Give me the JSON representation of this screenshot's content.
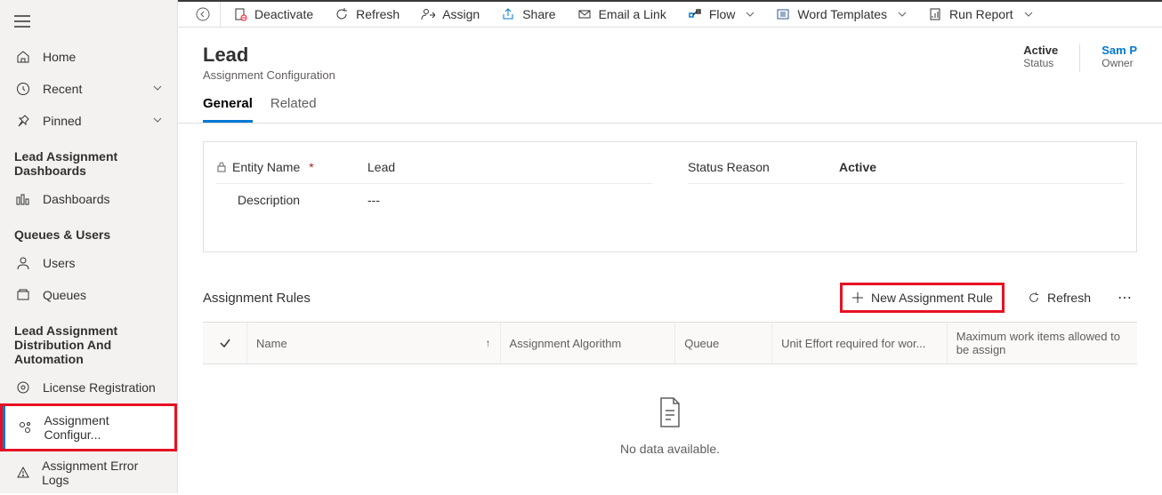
{
  "sidebar": {
    "primary": [
      {
        "label": "Home",
        "icon": "home"
      },
      {
        "label": "Recent",
        "icon": "clock",
        "expandable": true
      },
      {
        "label": "Pinned",
        "icon": "pin",
        "expandable": true
      }
    ],
    "groups": [
      {
        "title": "Lead Assignment Dashboards",
        "items": [
          {
            "label": "Dashboards",
            "icon": "dashboard"
          }
        ]
      },
      {
        "title": "Queues & Users",
        "items": [
          {
            "label": "Users",
            "icon": "person"
          },
          {
            "label": "Queues",
            "icon": "queue"
          }
        ]
      },
      {
        "title": "Lead Assignment Distribution And Automation",
        "items": [
          {
            "label": "License Registration",
            "icon": "license"
          },
          {
            "label": "Assignment Configur...",
            "icon": "config",
            "active": true
          },
          {
            "label": "Assignment Error Logs",
            "icon": "errorlog"
          }
        ]
      }
    ]
  },
  "commandbar": [
    {
      "label": "Deactivate",
      "icon": "deactivate"
    },
    {
      "label": "Refresh",
      "icon": "refresh"
    },
    {
      "label": "Assign",
      "icon": "assign"
    },
    {
      "label": "Share",
      "icon": "share"
    },
    {
      "label": "Email a Link",
      "icon": "email"
    },
    {
      "label": "Flow",
      "icon": "flow",
      "dropdown": true
    },
    {
      "label": "Word Templates",
      "icon": "word",
      "dropdown": true
    },
    {
      "label": "Run Report",
      "icon": "report",
      "dropdown": true
    }
  ],
  "header": {
    "title": "Lead",
    "subtitle": "Assignment Configuration",
    "status_value": "Active",
    "status_label": "Status",
    "owner_value": "Sam P",
    "owner_label": "Owner"
  },
  "tabs": [
    {
      "label": "General",
      "active": true
    },
    {
      "label": "Related"
    }
  ],
  "form": {
    "entity_name_label": "Entity Name",
    "entity_name_value": "Lead",
    "status_reason_label": "Status Reason",
    "status_reason_value": "Active",
    "description_label": "Description",
    "description_value": "---"
  },
  "assignment_rules": {
    "title": "Assignment Rules",
    "new_button": "New Assignment Rule",
    "refresh_button": "Refresh",
    "columns": {
      "name": "Name",
      "algorithm": "Assignment Algorithm",
      "queue": "Queue",
      "effort": "Unit Effort required for wor...",
      "max": "Maximum work items allowed to be assign"
    },
    "empty_message": "No data available."
  }
}
